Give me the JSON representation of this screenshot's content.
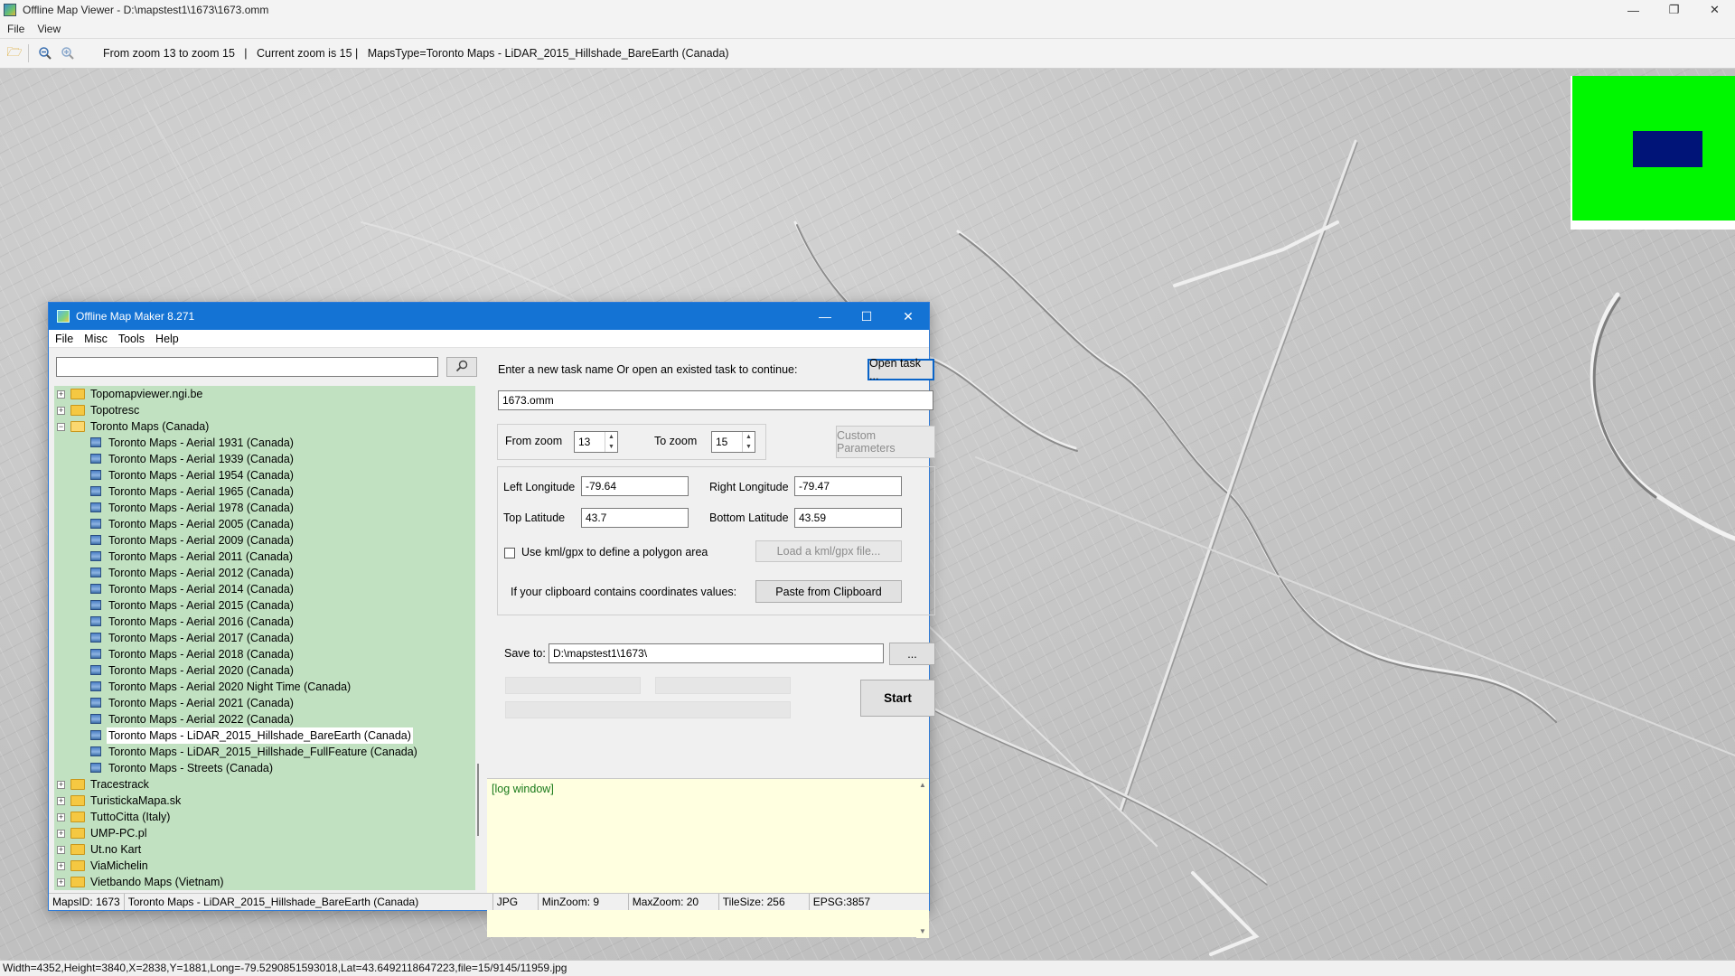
{
  "viewer": {
    "title": "Offline Map Viewer - D:\\mapstest1\\1673\\1673.omm",
    "menu": [
      "File",
      "View"
    ],
    "toolbar_info": "From zoom 13 to zoom 15   |   Current zoom is 15 |   MapsType=Toronto Maps - LiDAR_2015_Hillshade_BareEarth (Canada)",
    "status": "Width=4352,Height=3840,X=2838,Y=1881,Long=-79.5290851593018,Lat=43.6492118647223,file=15/9145/11959.jpg",
    "overview_colors": {
      "frame": "#00f700",
      "viewport": "#001478"
    }
  },
  "dialog": {
    "title": "Offline Map Maker 8.271",
    "menu": [
      "File",
      "Misc",
      "Tools",
      "Help"
    ],
    "search": {
      "value": "",
      "placeholder": ""
    },
    "tree": [
      {
        "label": "Topomapviewer.ngi.be",
        "level": 0,
        "expander": "+",
        "open": false
      },
      {
        "label": "Topotresc",
        "level": 0,
        "expander": "+",
        "open": false
      },
      {
        "label": "Toronto Maps (Canada)",
        "level": 0,
        "expander": "−",
        "open": true
      },
      {
        "label": "Toronto Maps - Aerial 1931 (Canada)",
        "level": 1
      },
      {
        "label": "Toronto Maps - Aerial 1939 (Canada)",
        "level": 1
      },
      {
        "label": "Toronto Maps - Aerial 1954 (Canada)",
        "level": 1
      },
      {
        "label": "Toronto Maps - Aerial 1965 (Canada)",
        "level": 1
      },
      {
        "label": "Toronto Maps - Aerial 1978 (Canada)",
        "level": 1
      },
      {
        "label": "Toronto Maps - Aerial 2005 (Canada)",
        "level": 1
      },
      {
        "label": "Toronto Maps - Aerial 2009 (Canada)",
        "level": 1
      },
      {
        "label": "Toronto Maps - Aerial 2011 (Canada)",
        "level": 1
      },
      {
        "label": "Toronto Maps - Aerial 2012 (Canada)",
        "level": 1
      },
      {
        "label": "Toronto Maps - Aerial 2014 (Canada)",
        "level": 1
      },
      {
        "label": "Toronto Maps - Aerial 2015 (Canada)",
        "level": 1
      },
      {
        "label": "Toronto Maps - Aerial 2016 (Canada)",
        "level": 1
      },
      {
        "label": "Toronto Maps - Aerial 2017 (Canada)",
        "level": 1
      },
      {
        "label": "Toronto Maps - Aerial 2018 (Canada)",
        "level": 1
      },
      {
        "label": "Toronto Maps - Aerial 2020 (Canada)",
        "level": 1
      },
      {
        "label": "Toronto Maps - Aerial 2020 Night Time (Canada)",
        "level": 1
      },
      {
        "label": "Toronto Maps - Aerial 2021 (Canada)",
        "level": 1
      },
      {
        "label": "Toronto Maps - Aerial 2022 (Canada)",
        "level": 1
      },
      {
        "label": "Toronto Maps - LiDAR_2015_Hillshade_BareEarth (Canada)",
        "level": 1,
        "selected": true
      },
      {
        "label": "Toronto Maps - LiDAR_2015_Hillshade_FullFeature (Canada)",
        "level": 1
      },
      {
        "label": "Toronto Maps - Streets (Canada)",
        "level": 1
      },
      {
        "label": "Tracestrack",
        "level": 0,
        "expander": "+",
        "open": false
      },
      {
        "label": "TuristickaMapa.sk",
        "level": 0,
        "expander": "+",
        "open": false
      },
      {
        "label": "TuttoCitta (Italy)",
        "level": 0,
        "expander": "+",
        "open": false
      },
      {
        "label": "UMP-PC.pl",
        "level": 0,
        "expander": "+",
        "open": false
      },
      {
        "label": "Ut.no Kart",
        "level": 0,
        "expander": "+",
        "open": false
      },
      {
        "label": "ViaMichelin",
        "level": 0,
        "expander": "+",
        "open": false
      },
      {
        "label": "Vietbando Maps (Vietnam)",
        "level": 0,
        "expander": "+",
        "open": false
      }
    ],
    "task": {
      "prompt": "Enter a new task name Or open an existed task to continue:",
      "open_label": "Open task ...",
      "name_value": "1673.omm"
    },
    "zoom": {
      "from_label": "From zoom",
      "from_value": "13",
      "to_label": "To zoom",
      "to_value": "15",
      "custom_label": "Custom Parameters"
    },
    "coords": {
      "left_lon_label": "Left Longitude",
      "left_lon_value": "-79.64",
      "right_lon_label": "Right Longitude",
      "right_lon_value": "-79.47",
      "top_lat_label": "Top Latitude",
      "top_lat_value": "43.7",
      "bottom_lat_label": "Bottom Latitude",
      "bottom_lat_value": "43.59",
      "kml_label": "Use kml/gpx to define a polygon area",
      "kml_checked": false,
      "load_kml_label": "Load a kml/gpx file...",
      "clipboard_label": "If your clipboard contains coordinates values:",
      "paste_label": "Paste from Clipboard"
    },
    "save": {
      "label": "Save to:",
      "value": "D:\\mapstest1\\1673\\",
      "browse_label": "...",
      "start_label": "Start"
    },
    "log": {
      "text": "[log window]"
    },
    "status": {
      "maps_id": "MapsID: 1673",
      "maps_name": "Toronto Maps - LiDAR_2015_Hillshade_BareEarth (Canada)",
      "format": "JPG",
      "min_zoom": "MinZoom: 9",
      "max_zoom": "MaxZoom: 20",
      "tile_size": "TileSize: 256",
      "epsg": "EPSG:3857"
    }
  }
}
